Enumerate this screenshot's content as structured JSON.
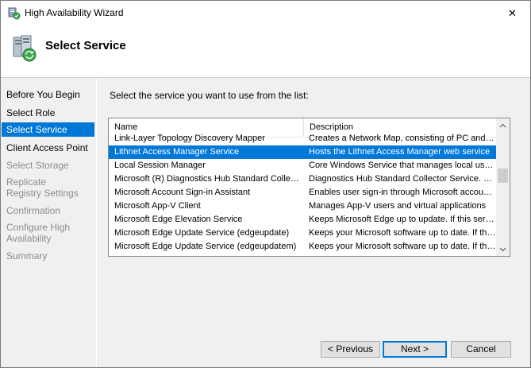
{
  "window": {
    "title": "High Availability Wizard",
    "close_symbol": "✕"
  },
  "header": {
    "title": "Select Service",
    "icon": "server-cluster-icon"
  },
  "sidebar": {
    "items": [
      {
        "label": "Before You Begin",
        "state": "normal"
      },
      {
        "label": "Select Role",
        "state": "normal"
      },
      {
        "label": "Select Service",
        "state": "active"
      },
      {
        "label": "Client Access Point",
        "state": "normal"
      },
      {
        "label": "Select Storage",
        "state": "disabled"
      },
      {
        "label": "Replicate Registry Settings",
        "state": "disabled"
      },
      {
        "label": "Confirmation",
        "state": "disabled"
      },
      {
        "label": "Configure High Availability",
        "state": "disabled"
      },
      {
        "label": "Summary",
        "state": "disabled"
      }
    ]
  },
  "main": {
    "instruction": "Select the service you want to use from the list:",
    "list": {
      "columns": [
        "Name",
        "Description"
      ],
      "rows": [
        {
          "name": "Link-Layer Topology Discovery Mapper",
          "description": "Creates a Network Map, consisting of PC and d...",
          "selected": false
        },
        {
          "name": "Lithnet Access Manager Service",
          "description": "Hosts the Lithnet Access Manager web service",
          "selected": true
        },
        {
          "name": "Local Session Manager",
          "description": "Core Windows Service that manages local user...",
          "selected": false
        },
        {
          "name": "Microsoft (R) Diagnostics Hub Standard Collecto...",
          "description": "Diagnostics Hub Standard Collector Service. W...",
          "selected": false
        },
        {
          "name": "Microsoft Account Sign-in Assistant",
          "description": "Enables user sign-in through Microsoft account ...",
          "selected": false
        },
        {
          "name": "Microsoft App-V Client",
          "description": "Manages App-V users and virtual applications",
          "selected": false
        },
        {
          "name": "Microsoft Edge Elevation Service",
          "description": "Keeps Microsoft Edge up to update. If this servi...",
          "selected": false
        },
        {
          "name": "Microsoft Edge Update Service (edgeupdate)",
          "description": "Keeps your Microsoft software up to date. If this...",
          "selected": false
        },
        {
          "name": "Microsoft Edge Update Service (edgeupdatem)",
          "description": "Keeps your Microsoft software up to date. If this...",
          "selected": false
        }
      ]
    }
  },
  "buttons": {
    "previous": "< Previous",
    "next": "Next >",
    "cancel": "Cancel"
  },
  "colors": {
    "accent": "#0078d7",
    "panel": "#f0f0f0",
    "disabled_text": "#8c8c8c"
  }
}
